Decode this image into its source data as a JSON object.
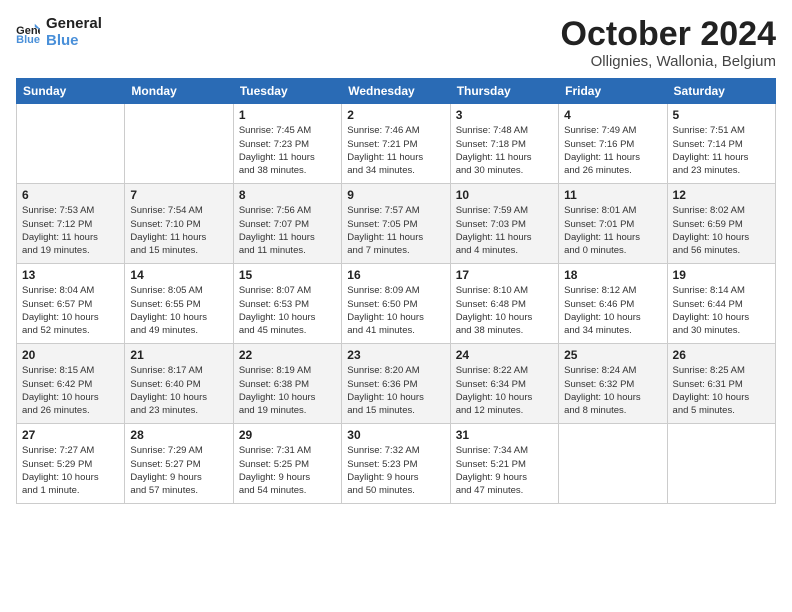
{
  "logo": {
    "line1": "General",
    "line2": "Blue"
  },
  "title": "October 2024",
  "location": "Ollignies, Wallonia, Belgium",
  "weekdays": [
    "Sunday",
    "Monday",
    "Tuesday",
    "Wednesday",
    "Thursday",
    "Friday",
    "Saturday"
  ],
  "weeks": [
    [
      {
        "day": "",
        "info": ""
      },
      {
        "day": "",
        "info": ""
      },
      {
        "day": "1",
        "info": "Sunrise: 7:45 AM\nSunset: 7:23 PM\nDaylight: 11 hours\nand 38 minutes."
      },
      {
        "day": "2",
        "info": "Sunrise: 7:46 AM\nSunset: 7:21 PM\nDaylight: 11 hours\nand 34 minutes."
      },
      {
        "day": "3",
        "info": "Sunrise: 7:48 AM\nSunset: 7:18 PM\nDaylight: 11 hours\nand 30 minutes."
      },
      {
        "day": "4",
        "info": "Sunrise: 7:49 AM\nSunset: 7:16 PM\nDaylight: 11 hours\nand 26 minutes."
      },
      {
        "day": "5",
        "info": "Sunrise: 7:51 AM\nSunset: 7:14 PM\nDaylight: 11 hours\nand 23 minutes."
      }
    ],
    [
      {
        "day": "6",
        "info": "Sunrise: 7:53 AM\nSunset: 7:12 PM\nDaylight: 11 hours\nand 19 minutes."
      },
      {
        "day": "7",
        "info": "Sunrise: 7:54 AM\nSunset: 7:10 PM\nDaylight: 11 hours\nand 15 minutes."
      },
      {
        "day": "8",
        "info": "Sunrise: 7:56 AM\nSunset: 7:07 PM\nDaylight: 11 hours\nand 11 minutes."
      },
      {
        "day": "9",
        "info": "Sunrise: 7:57 AM\nSunset: 7:05 PM\nDaylight: 11 hours\nand 7 minutes."
      },
      {
        "day": "10",
        "info": "Sunrise: 7:59 AM\nSunset: 7:03 PM\nDaylight: 11 hours\nand 4 minutes."
      },
      {
        "day": "11",
        "info": "Sunrise: 8:01 AM\nSunset: 7:01 PM\nDaylight: 11 hours\nand 0 minutes."
      },
      {
        "day": "12",
        "info": "Sunrise: 8:02 AM\nSunset: 6:59 PM\nDaylight: 10 hours\nand 56 minutes."
      }
    ],
    [
      {
        "day": "13",
        "info": "Sunrise: 8:04 AM\nSunset: 6:57 PM\nDaylight: 10 hours\nand 52 minutes."
      },
      {
        "day": "14",
        "info": "Sunrise: 8:05 AM\nSunset: 6:55 PM\nDaylight: 10 hours\nand 49 minutes."
      },
      {
        "day": "15",
        "info": "Sunrise: 8:07 AM\nSunset: 6:53 PM\nDaylight: 10 hours\nand 45 minutes."
      },
      {
        "day": "16",
        "info": "Sunrise: 8:09 AM\nSunset: 6:50 PM\nDaylight: 10 hours\nand 41 minutes."
      },
      {
        "day": "17",
        "info": "Sunrise: 8:10 AM\nSunset: 6:48 PM\nDaylight: 10 hours\nand 38 minutes."
      },
      {
        "day": "18",
        "info": "Sunrise: 8:12 AM\nSunset: 6:46 PM\nDaylight: 10 hours\nand 34 minutes."
      },
      {
        "day": "19",
        "info": "Sunrise: 8:14 AM\nSunset: 6:44 PM\nDaylight: 10 hours\nand 30 minutes."
      }
    ],
    [
      {
        "day": "20",
        "info": "Sunrise: 8:15 AM\nSunset: 6:42 PM\nDaylight: 10 hours\nand 26 minutes."
      },
      {
        "day": "21",
        "info": "Sunrise: 8:17 AM\nSunset: 6:40 PM\nDaylight: 10 hours\nand 23 minutes."
      },
      {
        "day": "22",
        "info": "Sunrise: 8:19 AM\nSunset: 6:38 PM\nDaylight: 10 hours\nand 19 minutes."
      },
      {
        "day": "23",
        "info": "Sunrise: 8:20 AM\nSunset: 6:36 PM\nDaylight: 10 hours\nand 15 minutes."
      },
      {
        "day": "24",
        "info": "Sunrise: 8:22 AM\nSunset: 6:34 PM\nDaylight: 10 hours\nand 12 minutes."
      },
      {
        "day": "25",
        "info": "Sunrise: 8:24 AM\nSunset: 6:32 PM\nDaylight: 10 hours\nand 8 minutes."
      },
      {
        "day": "26",
        "info": "Sunrise: 8:25 AM\nSunset: 6:31 PM\nDaylight: 10 hours\nand 5 minutes."
      }
    ],
    [
      {
        "day": "27",
        "info": "Sunrise: 7:27 AM\nSunset: 5:29 PM\nDaylight: 10 hours\nand 1 minute."
      },
      {
        "day": "28",
        "info": "Sunrise: 7:29 AM\nSunset: 5:27 PM\nDaylight: 9 hours\nand 57 minutes."
      },
      {
        "day": "29",
        "info": "Sunrise: 7:31 AM\nSunset: 5:25 PM\nDaylight: 9 hours\nand 54 minutes."
      },
      {
        "day": "30",
        "info": "Sunrise: 7:32 AM\nSunset: 5:23 PM\nDaylight: 9 hours\nand 50 minutes."
      },
      {
        "day": "31",
        "info": "Sunrise: 7:34 AM\nSunset: 5:21 PM\nDaylight: 9 hours\nand 47 minutes."
      },
      {
        "day": "",
        "info": ""
      },
      {
        "day": "",
        "info": ""
      }
    ]
  ]
}
